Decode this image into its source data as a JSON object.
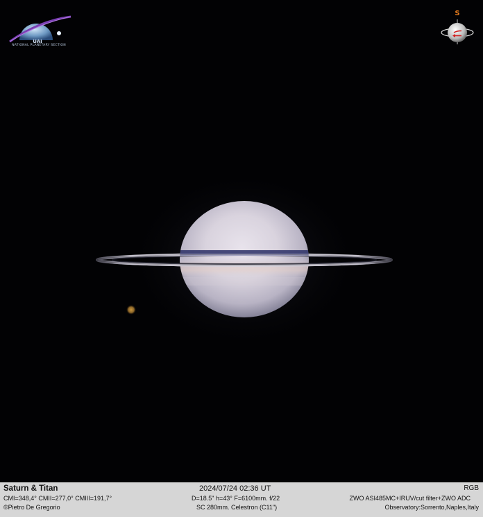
{
  "logo": {
    "name": "UAI",
    "subtitle": "NATIONAL PLANETARY SECTION"
  },
  "orientation": {
    "label": "S"
  },
  "caption": {
    "title": "Saturn & Titan",
    "central_meridians": "CMI=348,4° CMII=277,0° CMIII=191,7°",
    "credit": "©Pietro De Gregorio",
    "datetime": "2024/07/24   02:36 UT",
    "telescope_data": "D=18.5\" h=43° F=6100mm. f/22",
    "scope": "SC 280mm. Celestron (C11\")",
    "mode": "RGB",
    "camera": "ZWO ASI485MC+IRUV/cut filter+ZWO ADC",
    "observatory": "Observatory:Sorrento,Naples,Italy"
  },
  "colors": {
    "sky": "#020204",
    "caption_bar": "#d6d6d6",
    "orientation_arrow": "#d21f1f",
    "orientation_label": "#e27a1e",
    "titan": "#b7883a"
  }
}
